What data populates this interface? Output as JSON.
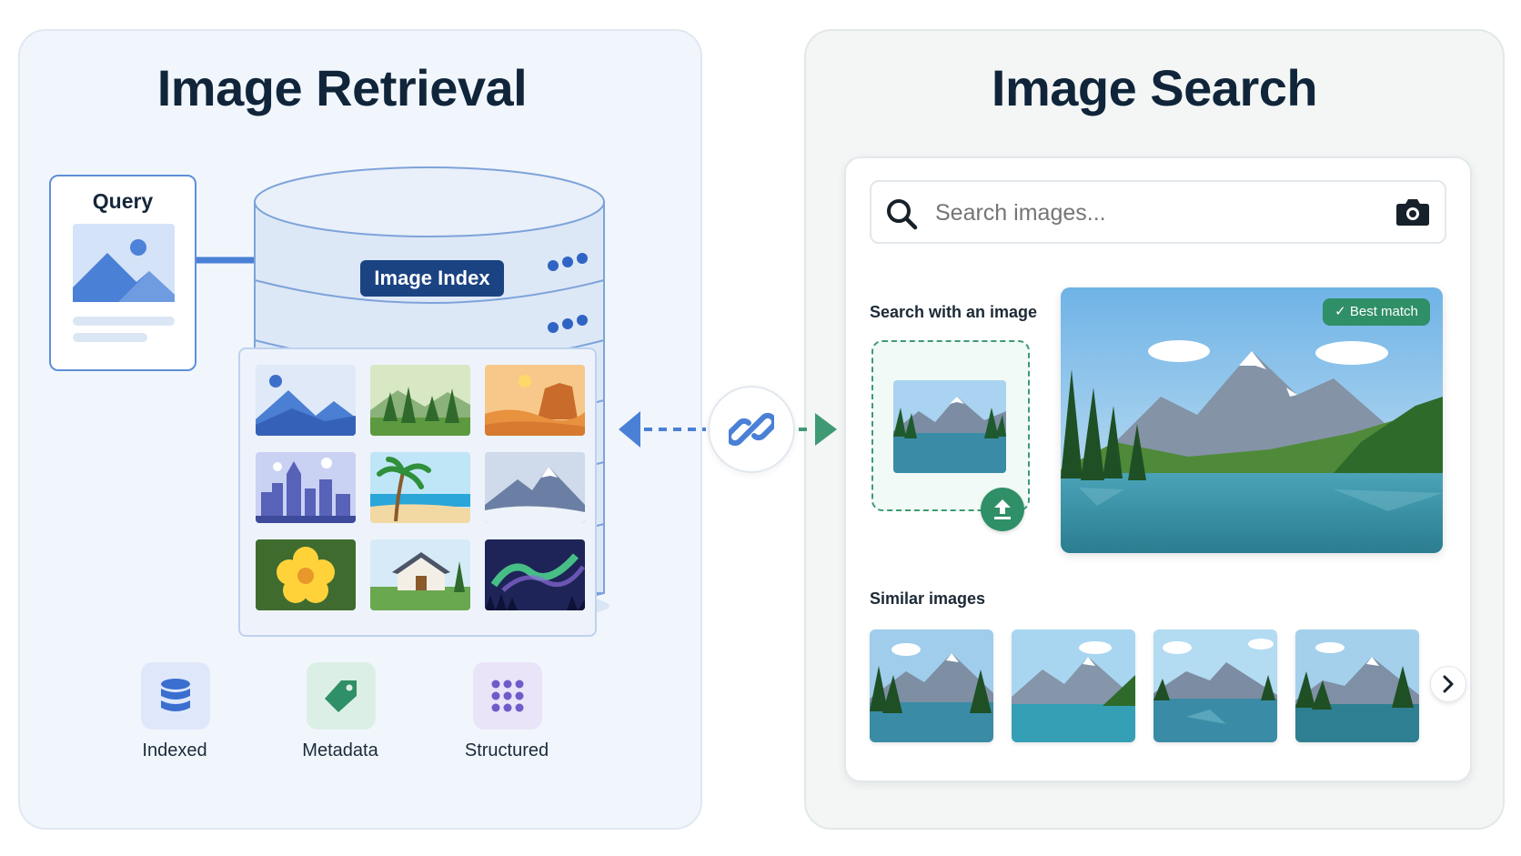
{
  "left": {
    "title": "Image Retrieval",
    "query_label": "Query",
    "index_label": "Image Index",
    "tiles": [
      "landscape-icon",
      "forest-icon",
      "desert-icon",
      "city-icon",
      "beach-icon",
      "snow-mountain-icon",
      "flower-icon",
      "house-icon",
      "aurora-icon"
    ],
    "features": [
      {
        "label": "Indexed",
        "icon": "database-icon"
      },
      {
        "label": "Metadata",
        "icon": "tag-icon"
      },
      {
        "label": "Structured",
        "icon": "grid-icon"
      }
    ]
  },
  "connector": {
    "icon": "link-icon"
  },
  "right": {
    "title": "Image Search",
    "search_placeholder": "Search images...",
    "search_with_label": "Search with an image",
    "best_match": "✓ Best match",
    "similar_label": "Similar images"
  },
  "colors": {
    "left_bg": "#f1f6fc",
    "right_bg": "#f3f6f5",
    "blue_accent": "#4a80d6",
    "navy": "#1b4382",
    "green_accent": "#2f8f67"
  }
}
